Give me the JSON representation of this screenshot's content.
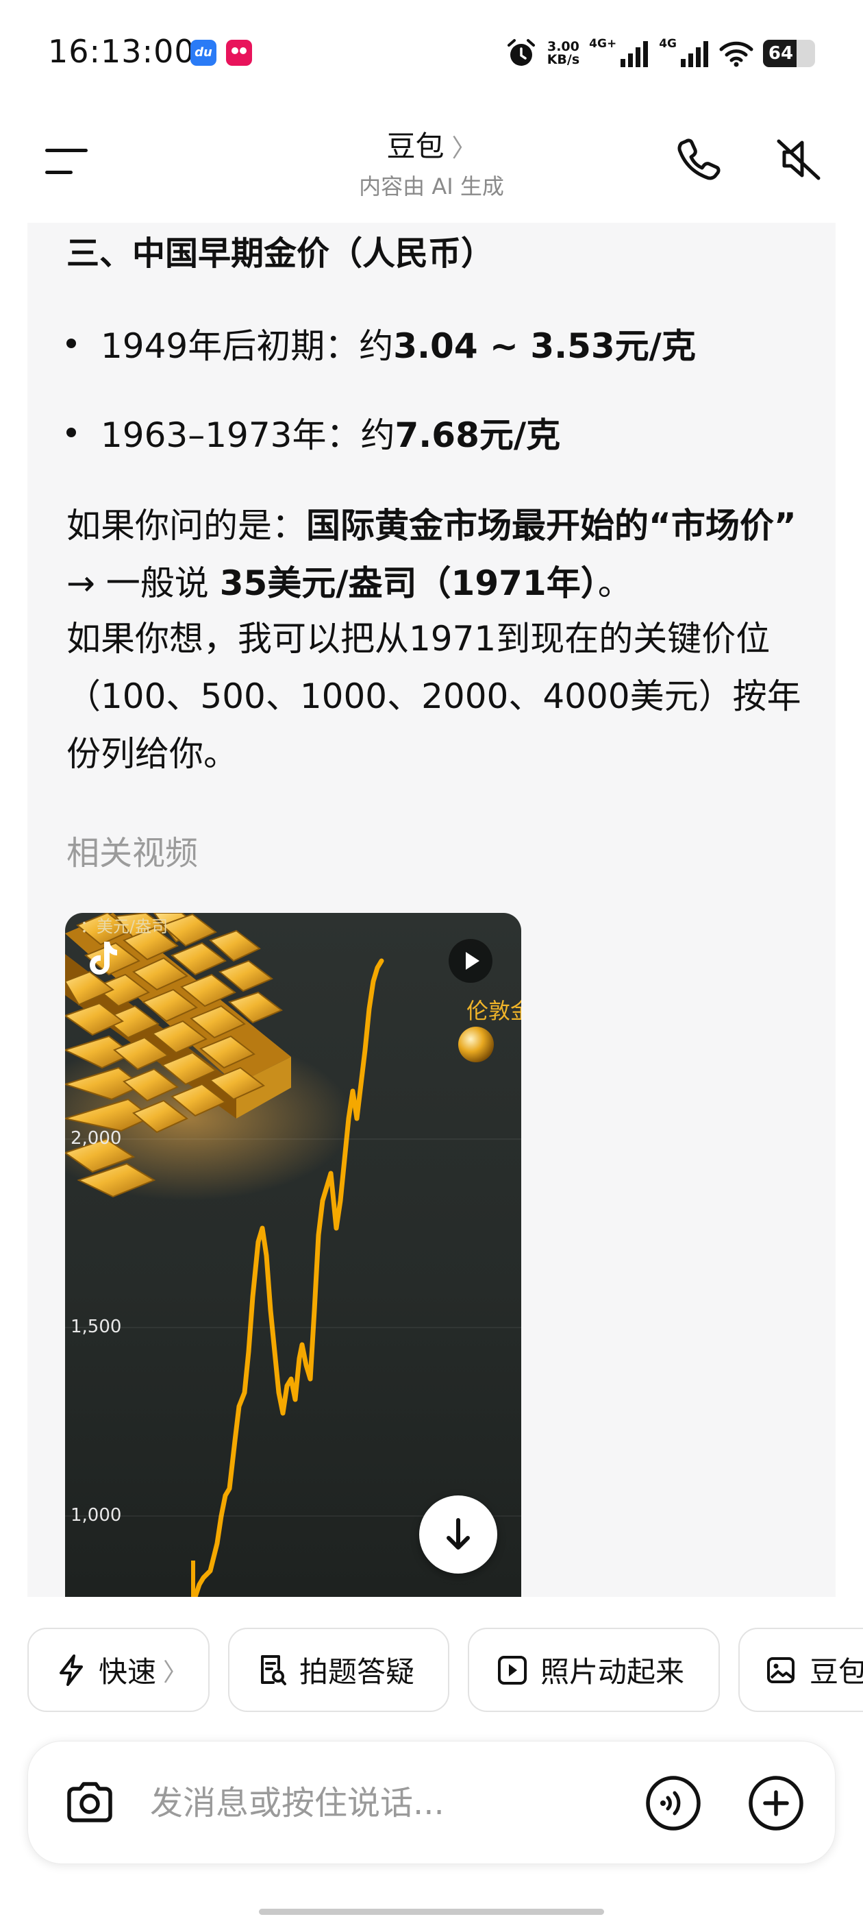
{
  "status_bar": {
    "time": "16:13:00",
    "app_badges": [
      "baidu-icon",
      "tmall-icon"
    ],
    "net_speed": "3.00",
    "net_speed_unit": "KB/s",
    "net_type_1": "4G+",
    "net_type_2": "4G",
    "battery_level": "64",
    "icons": [
      "alarm-icon",
      "signal-icon",
      "signal-icon",
      "wifi-icon",
      "battery-icon"
    ]
  },
  "header": {
    "title": "豆包",
    "title_chevron": "〉",
    "subtitle": "内容由 AI 生成",
    "icons": [
      "menu-icon",
      "phone-icon",
      "speaker-mute-icon"
    ]
  },
  "message": {
    "section_heading": "三、中国早期金价（人民币）",
    "bullets": [
      {
        "label": "1949年后初期：约 ",
        "value": "3.04 ~ 3.53元/克"
      },
      {
        "label": "1963–1973年：约 ",
        "value": "7.68元/克"
      }
    ],
    "para1": {
      "t1": "如果你问的是：",
      "b1": "国际黄金市场最开始的“市场价”",
      "t2": " → 一般说 ",
      "b2": "35美元/盎司（1971年）",
      "t3": "。"
    },
    "para2": "如果你想，我可以把从1971到现在的关键价位（100、500、1000、2000、4000美元）按年份列给你。",
    "related_videos_label": "相关视频"
  },
  "video": {
    "unit_label": "：美元/盎司",
    "y_ticks": [
      "2,000",
      "1,500",
      "1,000"
    ],
    "caption": "伦敦金",
    "icons": [
      "tiktok-icon",
      "play-icon",
      "download-icon"
    ],
    "line_color": "#f5a800"
  },
  "chips": [
    {
      "label": "快速",
      "icon": "lightning-icon",
      "chevron": "〉"
    },
    {
      "label": "拍题答疑",
      "icon": "scan-document-icon"
    },
    {
      "label": "照片动起来",
      "icon": "play-square-icon"
    },
    {
      "label": "豆包",
      "icon": "image-edit-icon"
    }
  ],
  "input": {
    "placeholder": "发消息或按住说话...",
    "icons": [
      "camera-icon",
      "voice-call-icon",
      "plus-icon"
    ]
  },
  "colors": {
    "card_bg": "#f6f6f7",
    "muted_text": "#9b9b9b",
    "gold_line": "#f5a800"
  }
}
